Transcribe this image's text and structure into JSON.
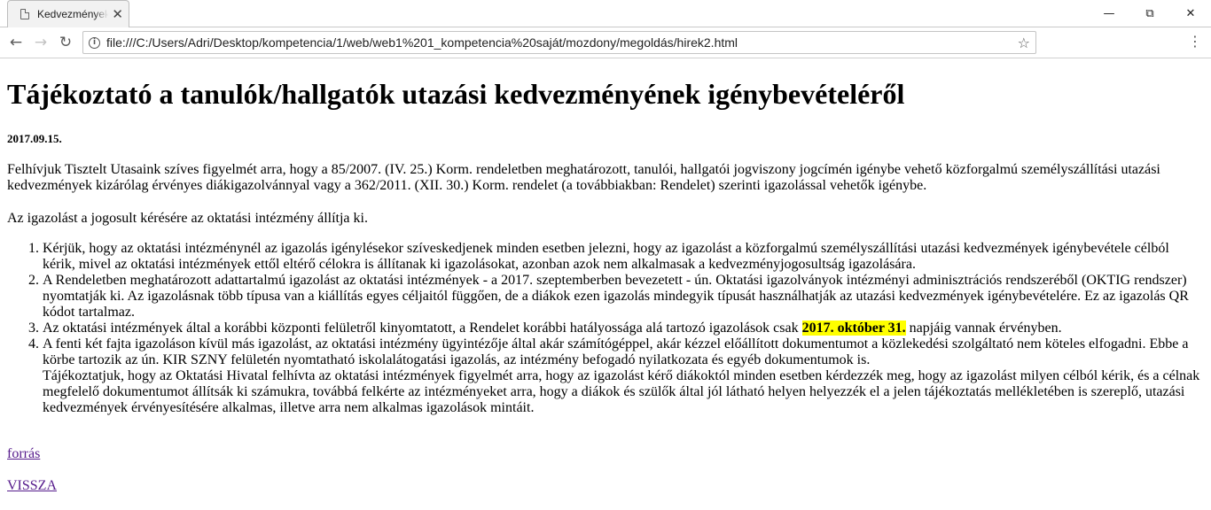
{
  "browser": {
    "tab_title": "Kedvezmények",
    "url": "file:///C:/Users/Adri/Desktop/kompetencia/1/web/web1%201_kompetencia%20saját/mozdony/megoldás/hirek2.html",
    "icons": [
      "page-icon",
      "close-icon",
      "back-icon",
      "forward-icon",
      "info-icon",
      "star-icon",
      "menu-icon",
      "minimize-icon",
      "restore-icon"
    ]
  },
  "article": {
    "title": "Tájékoztató a tanulók/hallgatók utazási kedvezményének igénybevételéről",
    "date": "2017.09.15.",
    "paragraph1": "Felhívjuk Tisztelt Utasaink szíves figyelmét arra, hogy a 85/2007. (IV. 25.) Korm. rendeletben meghatározott, tanulói, hallgatói jogviszony jogcímén igénybe vehető közforgalmú személyszállítási utazási kedvezmények kizárólag érvényes diákigazolvánnyal vagy a 362/2011. (XII. 30.) Korm. rendelet (a továbbiakban: Rendelet) szerinti igazolással vehetők igénybe.",
    "paragraph2": "Az igazolást a jogosult kérésére az oktatási intézmény állítja ki.",
    "items": [
      "Kérjük, hogy az oktatási intézménynél az igazolás igénylésekor szíveskedjenek minden esetben jelezni, hogy az igazolást a közforgalmú személyszállítási utazási kedvezmények igénybevétele célból kérik, mivel az oktatási intézmények ettől eltérő célokra is állítanak ki igazolásokat, azonban azok nem alkalmasak a kedvezményjogosultság igazolására.",
      "A Rendeletben meghatározott adattartalmú igazolást az oktatási intézmények - a 2017. szeptemberben bevezetett - ún. Oktatási igazolványok intézményi adminisztrációs rendszeréből (OKTIG rendszer) nyomtatják ki. Az igazolásnak több típusa van a kiállítás egyes céljaitól függően, de a diákok ezen igazolás mindegyik típusát használhatják az utazási kedvezmények igénybevételére. Ez az igazolás QR kódot tartalmaz."
    ],
    "item3": {
      "before": "Az oktatási intézmények által a korábbi központi felületről kinyomtatott, a Rendelet korábbi hatályossága alá tartozó igazolások csak ",
      "highlight": "2017. október 31.",
      "after": " napjáig vannak érvényben."
    },
    "item4": {
      "text": "A fenti két fajta igazoláson kívül más igazolást, az oktatási intézmény ügyintézője által akár számítógéppel, akár kézzel előállított dokumentumot a közlekedési szolgáltató nem köteles elfogadni. Ebbe a körbe tartozik az ún. KIR SZNY felületén nyomtatható iskolalátogatási igazolás, az intézmény befogadó nyilatkozata és egyéb dokumentumok is.",
      "extra": "Tájékoztatjuk, hogy az Oktatási Hivatal felhívta az oktatási intézmények figyelmét arra, hogy az igazolást kérő diákoktól minden esetben kérdezzék meg, hogy az igazolást milyen célból kérik, és a célnak megfelelő dokumentumot állítsák ki számukra, továbbá felkérte az intézményeket arra, hogy a diákok és szülők által jól látható helyen helyezzék el a jelen tájékoztatás mellékletében is szereplő, utazási kedvezmények érvényesítésére alkalmas, illetve arra nem alkalmas igazolások mintáit."
    },
    "source_link": "forrás",
    "back_link": "VISSZA",
    "highlight_color": "#ffff00",
    "visited_link_color": "#551a8b"
  }
}
